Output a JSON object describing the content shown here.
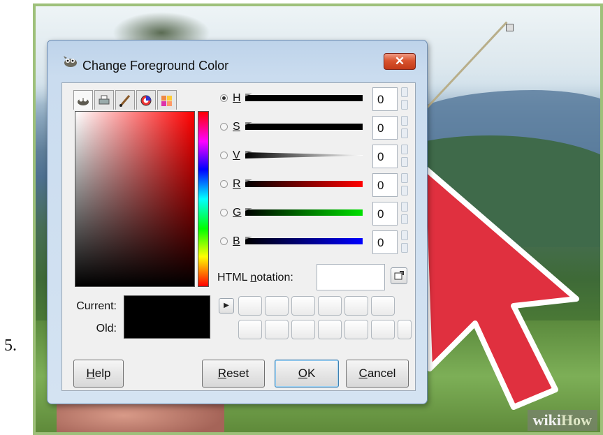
{
  "step": {
    "number": "5."
  },
  "watermark": {
    "wiki": "wiki",
    "how": "How"
  },
  "dialog": {
    "title": "Change Foreground Color",
    "close_symbol": "✕",
    "tabs": [
      "gimp-icon",
      "printer-icon",
      "paintbrush-icon",
      "color-wheel-icon",
      "palette-icon"
    ],
    "channels": [
      {
        "label": "H",
        "value": "0",
        "selected": true
      },
      {
        "label": "S",
        "value": "0",
        "selected": false
      },
      {
        "label": "V",
        "value": "0",
        "selected": false
      },
      {
        "label": "R",
        "value": "0",
        "selected": false
      },
      {
        "label": "G",
        "value": "0",
        "selected": false
      },
      {
        "label": "B",
        "value": "0",
        "selected": false
      }
    ],
    "html_notation": {
      "prefix": "HTML ",
      "underlined": "n",
      "suffix": "otation:",
      "value": ""
    },
    "current_label": "Current:",
    "old_label": "Old:",
    "current_color": "#000000",
    "buttons": {
      "help": {
        "u": "H",
        "rest": "elp"
      },
      "reset": {
        "u": "R",
        "rest": "eset"
      },
      "ok": {
        "u": "O",
        "rest": "K"
      },
      "cancel": {
        "u": "C",
        "rest": "ancel"
      }
    }
  },
  "colors": {
    "close_red": "#d9542f",
    "arrow_red": "#e0303f",
    "hue_slider": "#000000",
    "r_slider": "#ff0000",
    "g_slider": "#00e000",
    "b_slider": "#0000ff"
  }
}
